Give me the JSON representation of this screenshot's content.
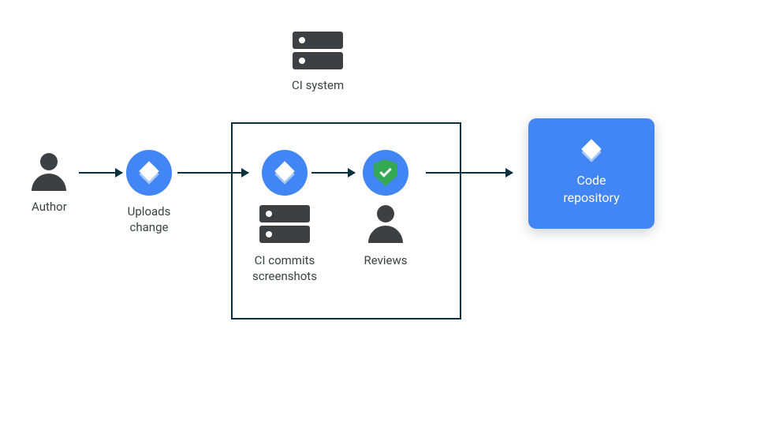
{
  "ci_system": {
    "label": "CI system"
  },
  "author": {
    "label": "Author"
  },
  "upload": {
    "label": "Uploads\nchange"
  },
  "ci_commits": {
    "label": "CI commits\nscreenshots"
  },
  "reviews": {
    "label": "Reviews"
  },
  "repo": {
    "label": "Code\nrepository"
  }
}
